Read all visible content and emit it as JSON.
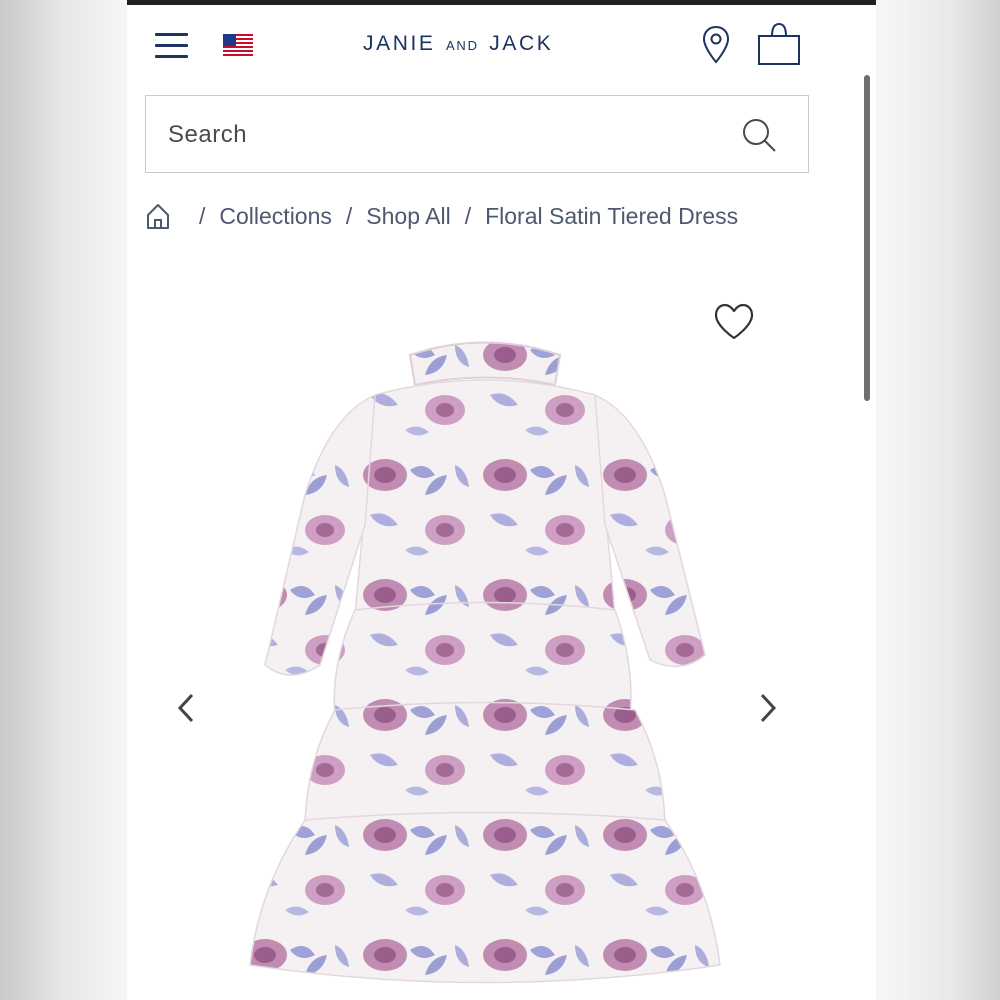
{
  "header": {
    "brand_left": "JANIE",
    "brand_mid": "AND",
    "brand_right": "JACK"
  },
  "search": {
    "placeholder": "Search"
  },
  "breadcrumb": {
    "items": [
      {
        "label": "Collections"
      },
      {
        "label": "Shop All"
      },
      {
        "label": "Floral Satin Tiered Dress"
      }
    ],
    "separator": "/"
  },
  "icons": {
    "menu": "hamburger-menu-icon",
    "flag": "us-flag-icon",
    "location": "map-pin-icon",
    "bag": "shopping-bag-icon",
    "search": "search-icon",
    "home": "home-icon",
    "favorite": "heart-icon",
    "prev": "chevron-left-icon",
    "next": "chevron-right-icon"
  },
  "colors": {
    "brand_navy": "#1d3461",
    "breadcrumb_text": "#4d5970",
    "dress_base": "#f4f0f2",
    "rose": "#b77aa7",
    "leaf": "#8a8fd0"
  }
}
